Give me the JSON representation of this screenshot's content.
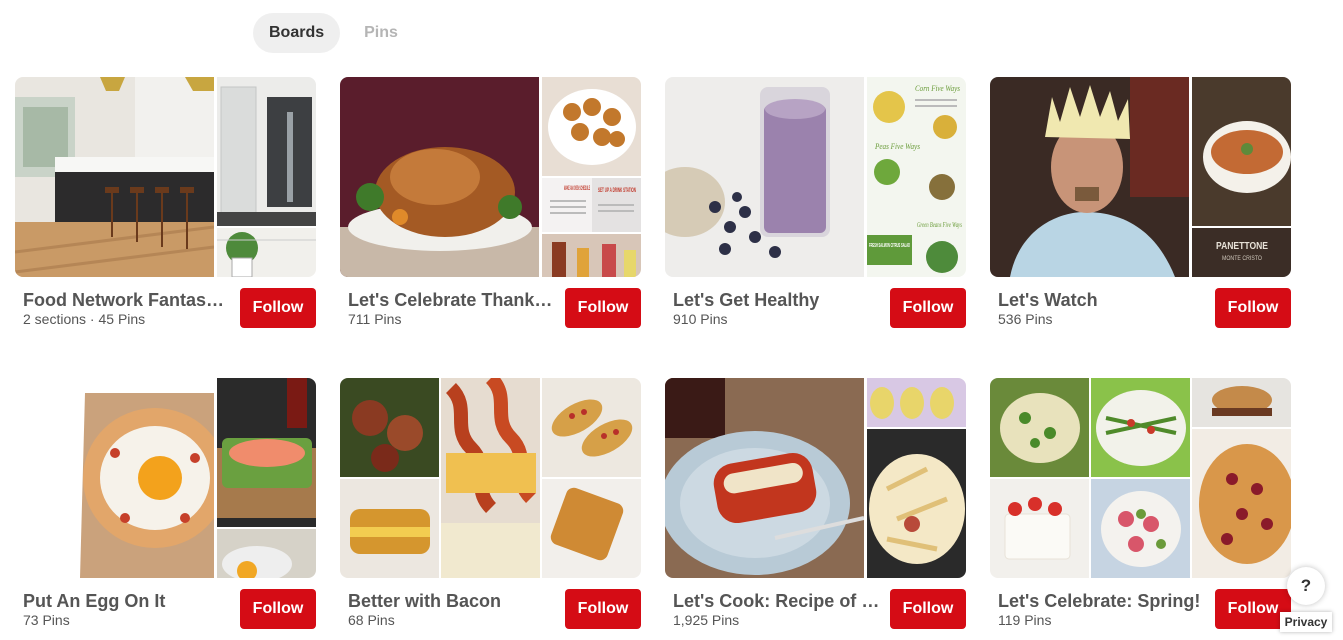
{
  "tabs": [
    {
      "label": "Boards",
      "active": true
    },
    {
      "label": "Pins",
      "active": false
    }
  ],
  "follow_label": "Follow",
  "boards": [
    {
      "title": "Food Network Fantasy ...",
      "subtitle": "2 sections · 45 Pins"
    },
    {
      "title": "Let's Celebrate Thanks...",
      "subtitle": "711 Pins"
    },
    {
      "title": "Let's Get Healthy",
      "subtitle": "910 Pins"
    },
    {
      "title": "Let's Watch",
      "subtitle": "536 Pins"
    },
    {
      "title": "Put An Egg On It",
      "subtitle": "73 Pins"
    },
    {
      "title": "Better with Bacon",
      "subtitle": "68 Pins"
    },
    {
      "title": "Let's Cook: Recipe of th...",
      "subtitle": "1,925 Pins"
    },
    {
      "title": "Let's Celebrate: Spring!",
      "subtitle": "119 Pins"
    }
  ],
  "image_text": {
    "make_ahead": "MAKE AN OVEN SCHEDULE",
    "set_up_station": "SET UP A DRINK STATION",
    "corn_five_ways": "Corn Five Ways",
    "peas_five_ways": "Peas Five Ways",
    "green_beans_five_ways": "Green Beans Five Ways",
    "fresh_salmon": "FRESH SALMON CITRUS SALAD",
    "panettone": "PANETTONE",
    "monte_cristo": "MONTE CRISTO"
  },
  "help_label": "?",
  "privacy_label": "Privacy",
  "colors": {
    "follow_bg": "#d50c15",
    "tab_active_bg": "#efefef"
  }
}
